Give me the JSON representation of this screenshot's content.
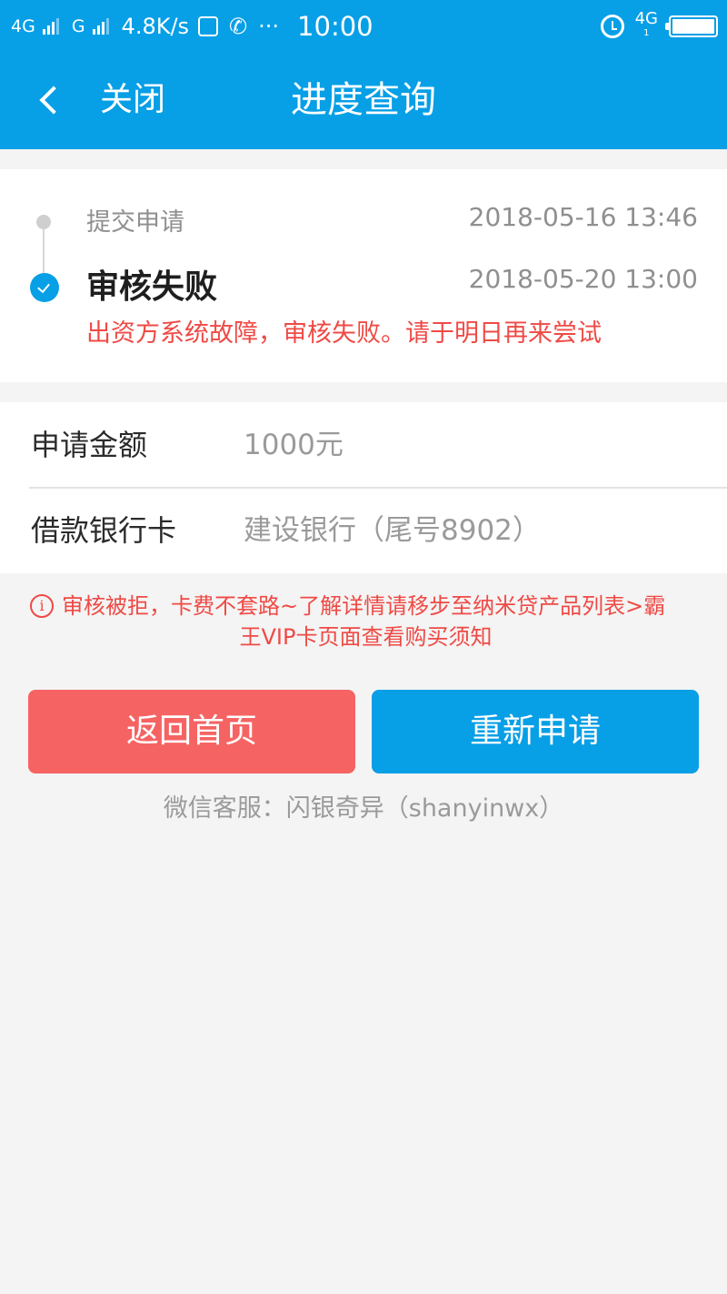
{
  "status_bar": {
    "network1": "4G",
    "network2": "G",
    "speed": "4.8K/s",
    "time": "10:00",
    "right_network": "4G",
    "right_network_sub": "1",
    "icons": [
      "signal-icon",
      "alipay-icon",
      "phone-icon",
      "more-icon",
      "alarm-icon",
      "battery-icon"
    ]
  },
  "header": {
    "close_label": "关闭",
    "title": "进度查询",
    "color": "#079fe6"
  },
  "timeline": {
    "steps": [
      {
        "label": "提交申请",
        "time": "2018-05-16 13:46"
      },
      {
        "label": "审核失败",
        "time": "2018-05-20 13:00",
        "reason": "出资方系统故障，审核失败。请于明日再来尝试"
      }
    ]
  },
  "info": {
    "rows": [
      {
        "label": "申请金额",
        "value": "1000元"
      },
      {
        "label": "借款银行卡",
        "value": "建设银行（尾号8902）"
      }
    ]
  },
  "notice": {
    "line1": "审核被拒，卡费不套路~了解详情请移步至纳米贷产品列表>霸",
    "line2": "王VIP卡页面查看购买须知",
    "color": "#ef4a45"
  },
  "buttons": {
    "home": "返回首页",
    "reapply": "重新申请",
    "home_color": "#f66363",
    "reapply_color": "#079fe6"
  },
  "footer": {
    "wechat": "微信客服：闪银奇异（shanyinwx）"
  }
}
